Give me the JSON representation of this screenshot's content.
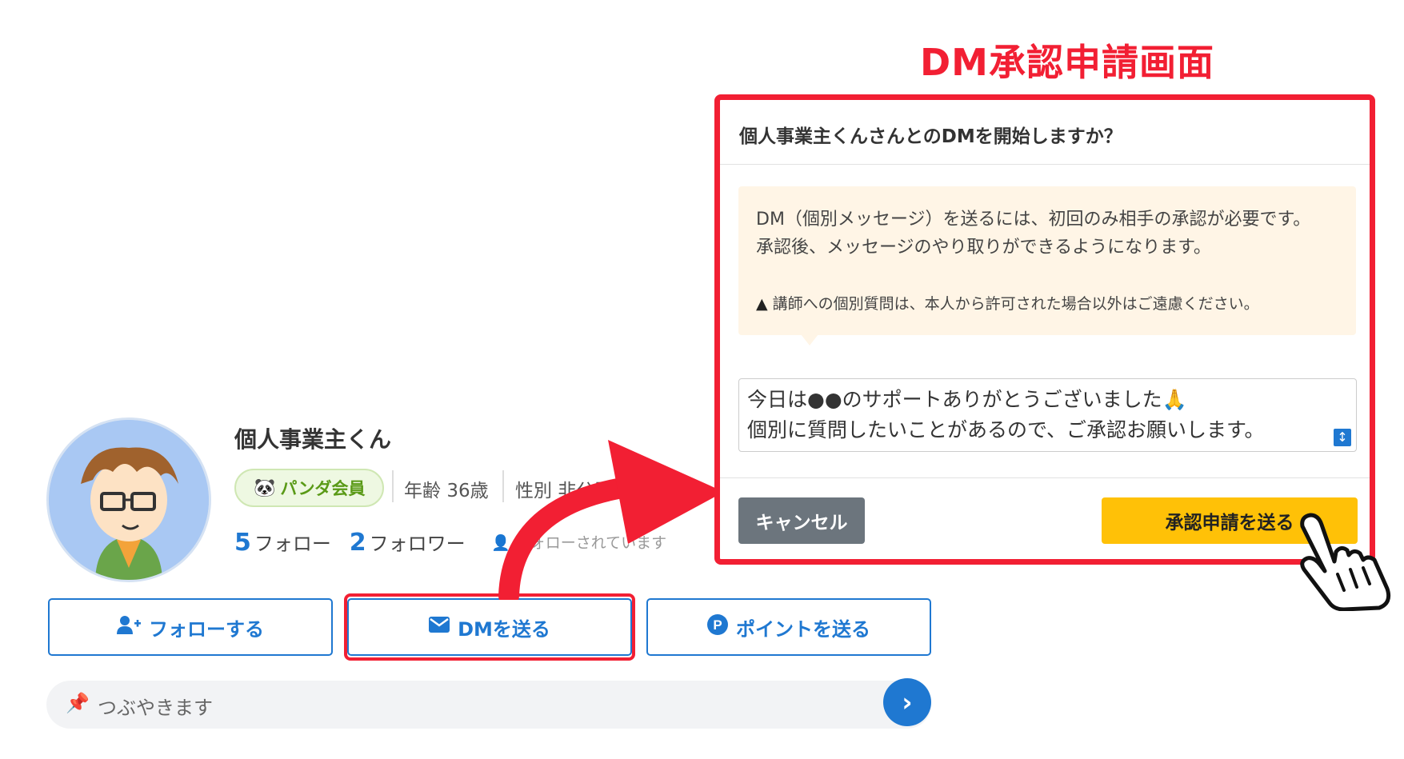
{
  "annotation": {
    "title": "DM承認申請画面"
  },
  "profile": {
    "name": "個人事業主くん",
    "badge": "パンダ会員",
    "age_label": "年齢",
    "age_value": "36歳",
    "gender_label": "性別",
    "gender_value": "非公開",
    "follow_count": "5",
    "follow_label": "フォロー",
    "follower_count": "2",
    "follower_label": "フォロワー",
    "followed_status": "フォローされています"
  },
  "actions": {
    "follow": "フォローする",
    "dm": "DMを送る",
    "points": "ポイントを送る"
  },
  "tweet": {
    "placeholder": "つぶやきます"
  },
  "modal": {
    "title": "個人事業主くんさんとのDMを開始しますか？",
    "notice_line1": "DM（個別メッセージ）を送るには、初回のみ相手の承認が必要です。",
    "notice_line2": "承認後、メッセージのやり取りができるようになります。",
    "warning": "講師への個別質問は、本人から許可された場合以外はご遠慮ください。",
    "message_line1": "今日は●●のサポートありがとうございました🙏",
    "message_line2": "個別に質問したいことがあるので、ご承認お願いします。",
    "cancel": "キャンセル",
    "submit": "承認申請を送る"
  },
  "colors": {
    "accent_red": "#f21f33",
    "primary_blue": "#1f78d1",
    "submit_yellow": "#ffc107",
    "cancel_gray": "#6c757d",
    "badge_green": "#5a9a17",
    "notice_bg": "#fff5e6"
  },
  "icons": {
    "follow": "user-plus-icon",
    "dm": "envelope-icon",
    "points": "point-p-icon",
    "pin": "pin-icon",
    "send": "chevron-right-icon",
    "warning": "warning-triangle-icon"
  }
}
